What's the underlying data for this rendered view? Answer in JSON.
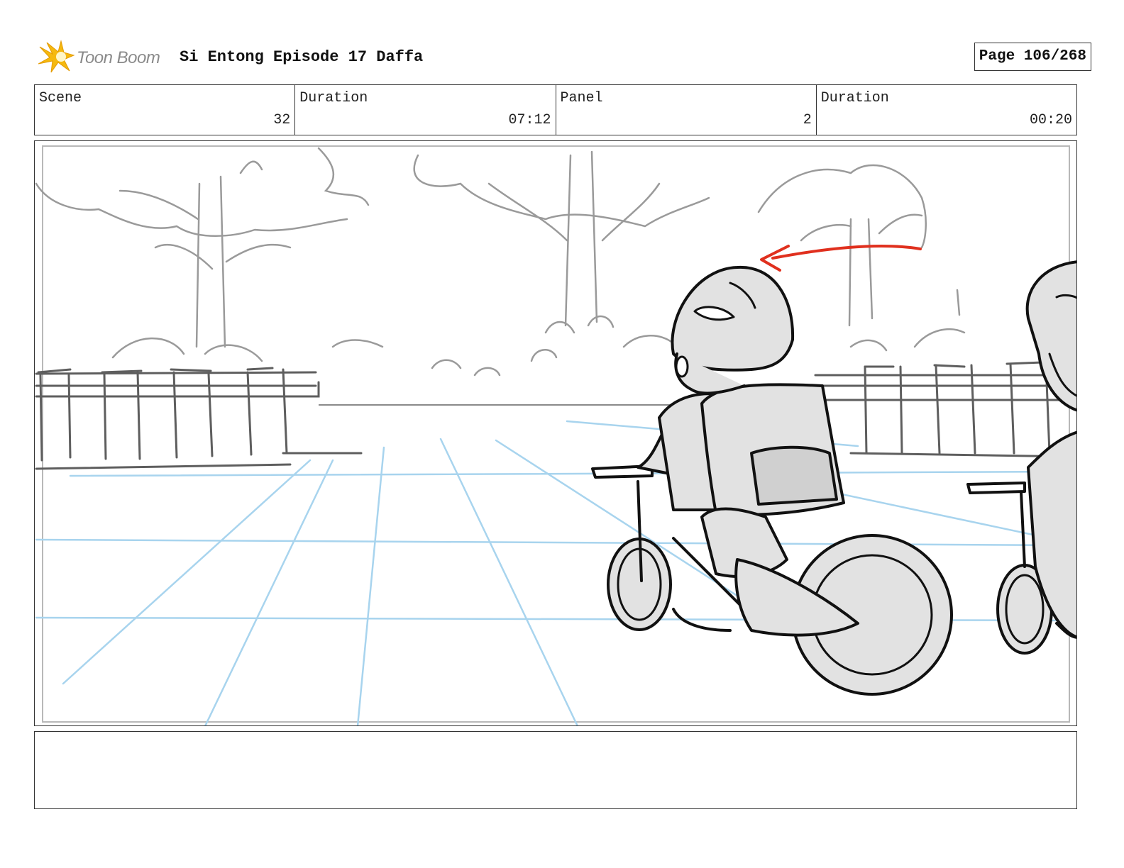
{
  "header": {
    "logo_text": "Toon Boom",
    "logo_icon": "toon-boom-star-icon",
    "title": "Si Entong Episode 17 Daffa",
    "page": "Page 106/268"
  },
  "info": {
    "scene_label": "Scene",
    "scene_value": "32",
    "scene_duration_label": "Duration",
    "scene_duration_value": "07:12",
    "panel_label": "Panel",
    "panel_value": "2",
    "panel_duration_label": "Duration",
    "panel_duration_value": "00:20"
  },
  "colors": {
    "accent_star": "#f5b90f",
    "perspective_grid": "#a8d4ee",
    "motion_arrow": "#e0301e",
    "sketch_background": "#9a9a9a",
    "sketch_character": "#111111",
    "character_fill": "#e2e2e2"
  },
  "notes": {
    "text": ""
  }
}
